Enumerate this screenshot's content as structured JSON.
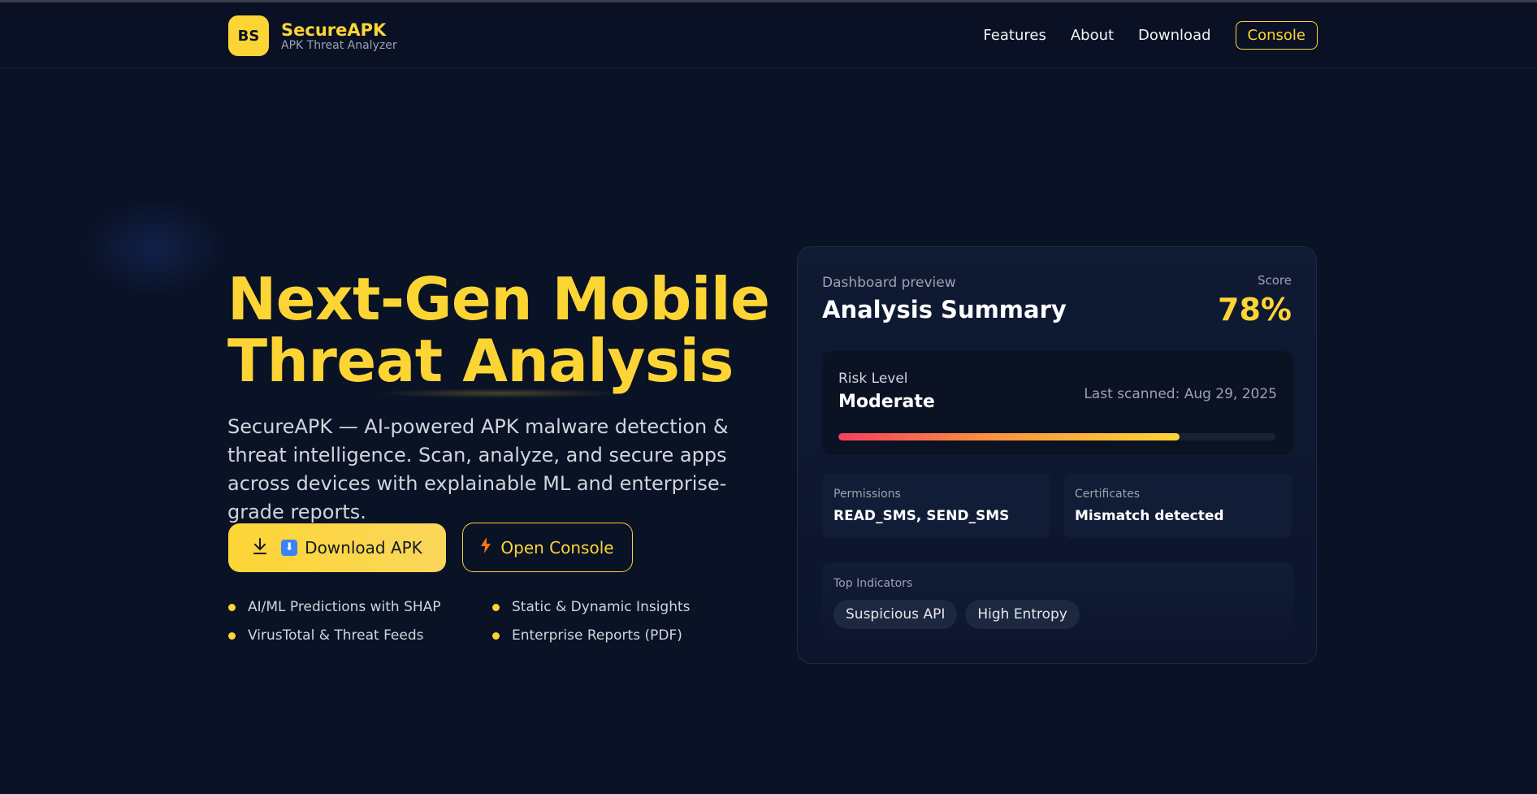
{
  "nav": {
    "logo_initials": "BS",
    "brand_name": "SecureAPK",
    "brand_sub": "APK Threat Analyzer",
    "links": [
      "Features",
      "About",
      "Download"
    ],
    "console_label": "Console"
  },
  "hero": {
    "title_line1": "Next-Gen Mobile",
    "title_line2": "Threat Analysis",
    "description": "SecureAPK — AI-powered APK malware detection & threat intelligence. Scan, analyze, and secure apps across devices with explainable ML and enterprise-grade reports.",
    "primary_button": "Download APK",
    "primary_emoji": "⬇",
    "secondary_button": "Open Console",
    "features": [
      "AI/ML Predictions with SHAP",
      "Static & Dynamic Insights",
      "VirusTotal & Threat Feeds",
      "Enterprise Reports (PDF)"
    ]
  },
  "card": {
    "kicker": "Dashboard preview",
    "title": "Analysis Summary",
    "score_label": "Score",
    "score_value": "78%",
    "risk_label": "Risk Level",
    "risk_value": "Moderate",
    "last_scanned": "Last scanned: Aug 29, 2025",
    "risk_fraction": 0.78,
    "permissions_label": "Permissions",
    "permissions_value": "READ_SMS, SEND_SMS",
    "certificates_label": "Certificates",
    "certificates_value": "Mismatch detected",
    "indicators_label": "Top Indicators",
    "indicators": [
      "Suspicious API",
      "High Entropy"
    ]
  },
  "colors": {
    "background": "#0a1226",
    "accent": "#fcd535",
    "danger": "#f43f5e"
  }
}
